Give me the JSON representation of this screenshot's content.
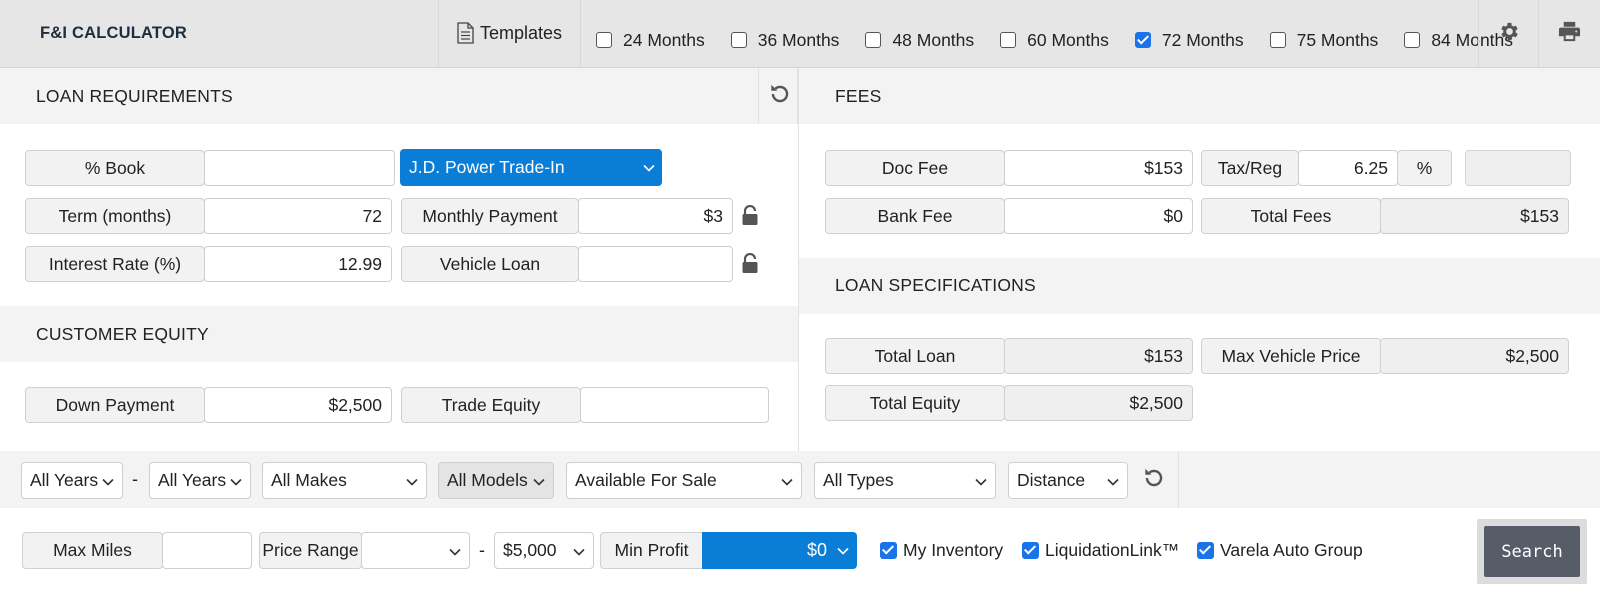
{
  "app": {
    "title": "F&I CALCULATOR"
  },
  "toolbar": {
    "templates_label": "Templates",
    "terms": [
      {
        "label": "24 Months",
        "checked": false
      },
      {
        "label": "36 Months",
        "checked": false
      },
      {
        "label": "48 Months",
        "checked": false
      },
      {
        "label": "60 Months",
        "checked": false
      },
      {
        "label": "72 Months",
        "checked": true
      },
      {
        "label": "75 Months",
        "checked": false
      },
      {
        "label": "84 Months",
        "checked": false
      }
    ],
    "icons": {
      "templates": "document-icon",
      "settings": "gear-icon",
      "print": "printer-icon"
    }
  },
  "loan_requirements": {
    "heading": "LOAN REQUIREMENTS",
    "book_label": "% Book",
    "book_value": "",
    "book_source": "J.D. Power Trade-In",
    "term_label": "Term (months)",
    "term_value": "72",
    "rate_label": "Interest Rate (%)",
    "rate_value": "12.99",
    "monthly_label": "Monthly Payment",
    "monthly_value": "$3",
    "vehicle_loan_label": "Vehicle Loan",
    "vehicle_loan_value": ""
  },
  "customer_equity": {
    "heading": "CUSTOMER EQUITY",
    "down_label": "Down Payment",
    "down_value": "$2,500",
    "trade_label": "Trade Equity",
    "trade_value": ""
  },
  "fees": {
    "heading": "FEES",
    "doc_label": "Doc Fee",
    "doc_value": "$153",
    "tax_label": "Tax/Reg",
    "tax_value": "6.25",
    "tax_unit": "%",
    "tax_amount": "",
    "bank_label": "Bank Fee",
    "bank_value": "$0",
    "total_label": "Total Fees",
    "total_value": "$153"
  },
  "loan_specs": {
    "heading": "LOAN SPECIFICATIONS",
    "total_loan_label": "Total Loan",
    "total_loan_value": "$153",
    "max_price_label": "Max Vehicle Price",
    "max_price_value": "$2,500",
    "total_equity_label": "Total Equity",
    "total_equity_value": "$2,500"
  },
  "filters": {
    "year_from": "All Years",
    "separator": "-",
    "year_to": "All Years",
    "makes": "All Makes",
    "models": "All Models",
    "availability": "Available For Sale",
    "types": "All Types",
    "distance": "Distance",
    "max_miles_label": "Max Miles",
    "max_miles_value": "",
    "price_range_label": "Price Range",
    "price_min": "",
    "price_max": "$5,000",
    "min_profit_label": "Min Profit",
    "min_profit_value": "$0",
    "sources": [
      {
        "label": "My Inventory",
        "checked": true
      },
      {
        "label": "LiquidationLink™",
        "checked": true
      },
      {
        "label": "Varela Auto Group",
        "checked": true
      }
    ],
    "search_label": "Search"
  },
  "colors": {
    "accent": "#0a7ed6",
    "checkbox": "#1a73e8",
    "search_button": "#565d69"
  }
}
